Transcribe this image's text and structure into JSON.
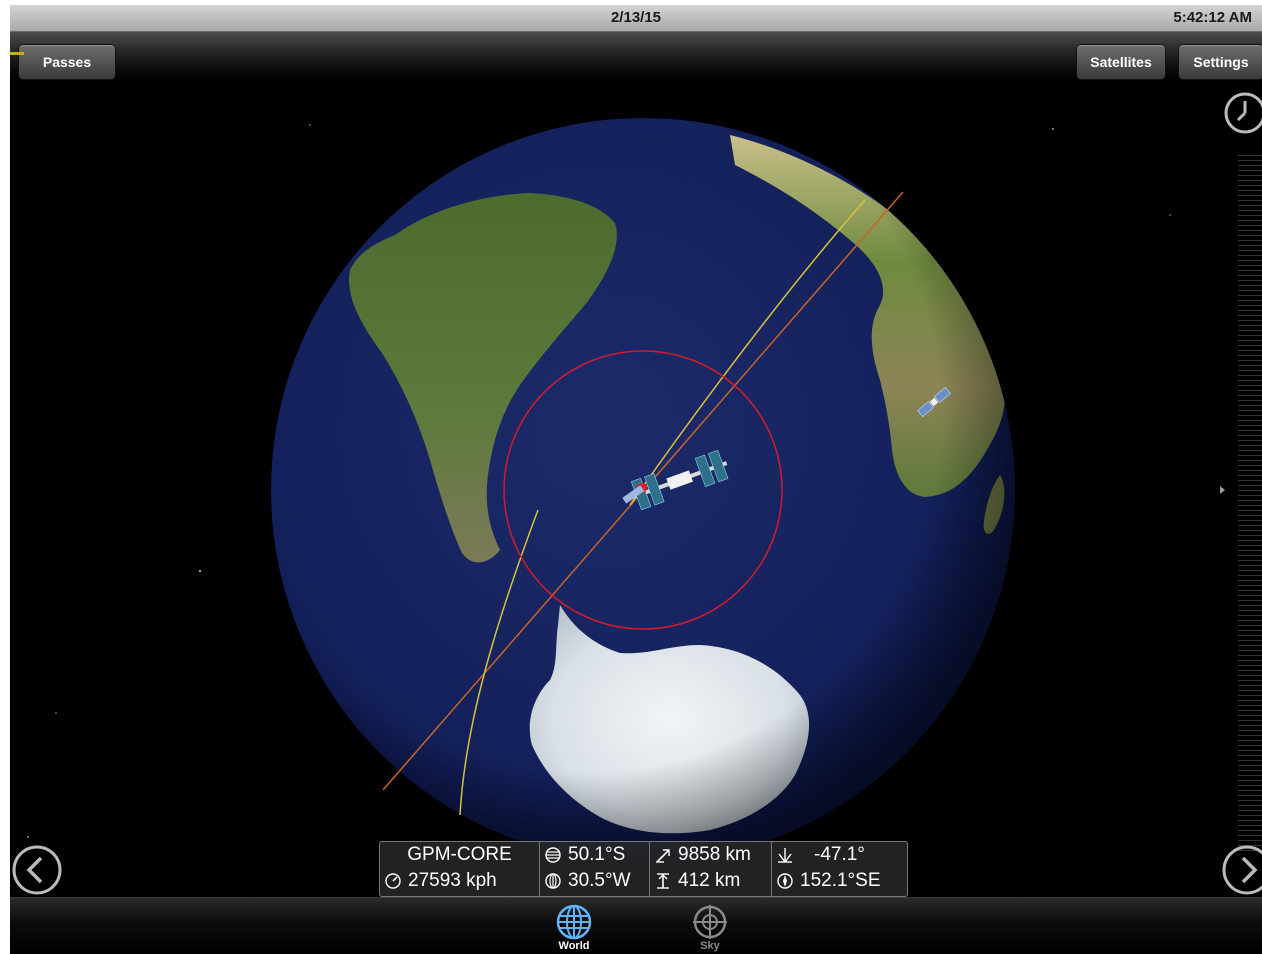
{
  "status_bar": {
    "date": "2/13/15",
    "time": "5:42:12 AM"
  },
  "toolbar": {
    "passes_label": "Passes",
    "satellites_label": "Satellites",
    "settings_label": "Settings"
  },
  "satellite_info": {
    "name": "GPM-CORE",
    "speed": "27593 kph",
    "latitude": "50.1°S",
    "longitude": "30.5°W",
    "range": "9858 km",
    "altitude": "412 km",
    "elevation": "-47.1°",
    "azimuth": "152.1°SE"
  },
  "tabs": [
    {
      "label": "World",
      "selected": true
    },
    {
      "label": "Sky",
      "selected": false
    }
  ],
  "icons": {
    "clock": "clock-icon",
    "previous": "chevron-left-icon",
    "next": "chevron-right-icon",
    "world": "globe-icon",
    "sky": "crosshair-icon"
  },
  "colors": {
    "accent": "#c8b400",
    "orbit_yellow": "#d4c23a",
    "orbit_orange": "#c8642a",
    "footprint": "#d21c2c",
    "tab_selected": "#5fb4ff"
  }
}
